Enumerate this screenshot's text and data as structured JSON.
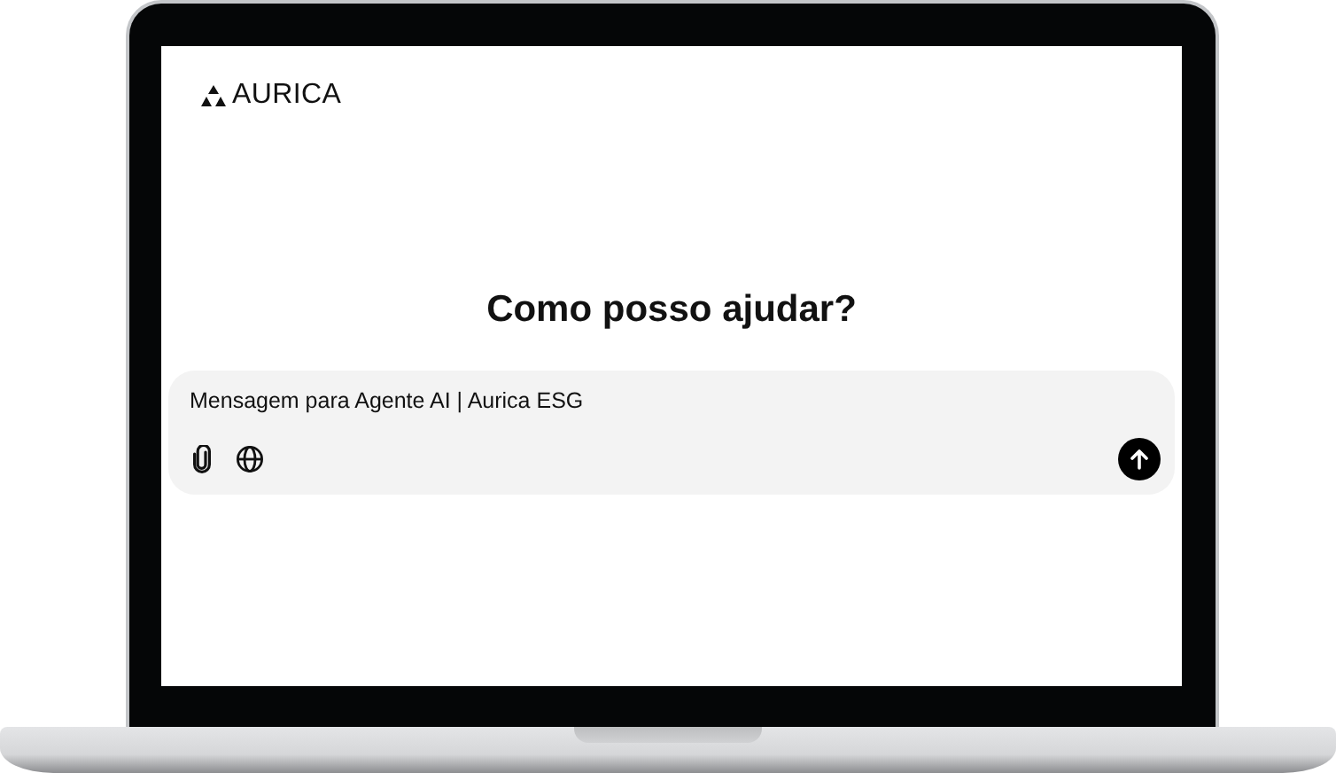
{
  "brand": {
    "name": "AURICA"
  },
  "heading": "Como posso ajudar?",
  "composer": {
    "value": "Mensagem para Agente AI | Aurica ESG"
  }
}
